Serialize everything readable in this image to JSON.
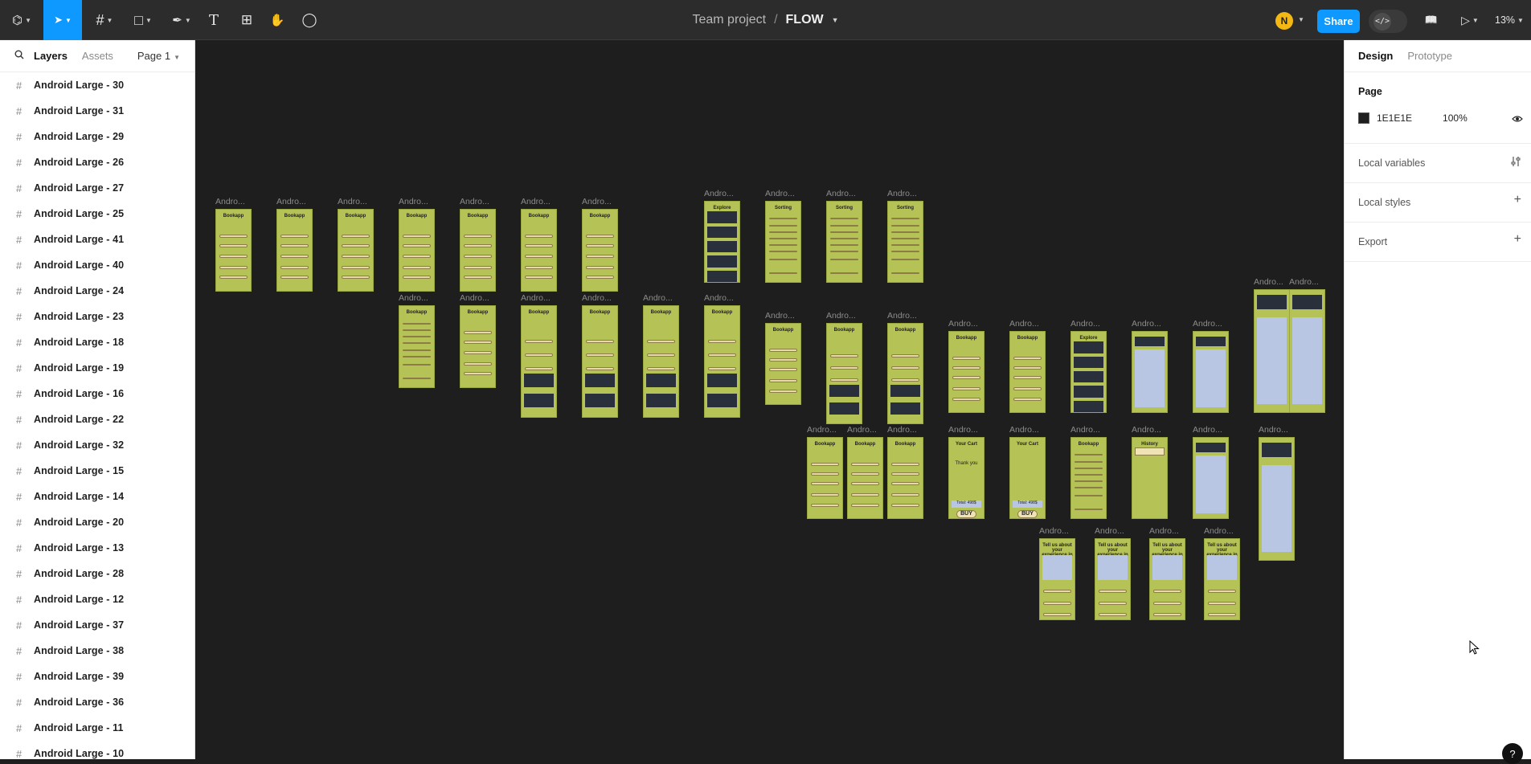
{
  "toolbar": {
    "tools": [
      {
        "name": "main-menu-icon",
        "glyph": "⌬"
      },
      {
        "name": "move-tool-icon",
        "glyph": "➤"
      },
      {
        "name": "frame-tool-icon",
        "glyph": "#"
      },
      {
        "name": "shape-tool-icon",
        "glyph": "□"
      },
      {
        "name": "pen-tool-icon",
        "glyph": "✒"
      },
      {
        "name": "text-tool-icon",
        "glyph": "T"
      },
      {
        "name": "resources-tool-icon",
        "glyph": "⊞"
      },
      {
        "name": "hand-tool-icon",
        "glyph": "✋"
      },
      {
        "name": "comment-tool-icon",
        "glyph": "◯"
      }
    ],
    "breadcrumb_team": "Team project",
    "breadcrumb_sep": "/",
    "file_name": "FLOW",
    "avatar_initial": "N",
    "share_label": "Share",
    "devmode_glyph": "</>",
    "library_glyph": "📖",
    "present_glyph": "▷",
    "zoom": "13%"
  },
  "left_panel": {
    "search_glyph": "🔍",
    "tab_layers": "Layers",
    "tab_assets": "Assets",
    "page_selector": "Page 1",
    "layers": [
      "Android Large - 30",
      "Android Large - 31",
      "Android Large - 29",
      "Android Large - 26",
      "Android Large - 27",
      "Android Large - 25",
      "Android Large - 41",
      "Android Large - 40",
      "Android Large - 24",
      "Android Large - 23",
      "Android Large - 18",
      "Android Large - 19",
      "Android Large - 16",
      "Android Large - 22",
      "Android Large - 32",
      "Android Large - 15",
      "Android Large - 14",
      "Android Large - 20",
      "Android Large - 13",
      "Android Large - 28",
      "Android Large - 12",
      "Android Large - 37",
      "Android Large - 38",
      "Android Large - 39",
      "Android Large - 36",
      "Android Large - 11",
      "Android Large - 10"
    ]
  },
  "right_panel": {
    "tab_design": "Design",
    "tab_prototype": "Prototype",
    "page_title": "Page",
    "page_color": "1E1E1E",
    "page_color_hex": "#1e1e1e",
    "page_opacity": "100%",
    "local_variables": "Local variables",
    "local_styles": "Local styles",
    "export": "Export"
  },
  "canvas": {
    "frame_label": "Andro...",
    "frame_color": "#b5c255",
    "background": "#1e1e1e",
    "frame_texts": {
      "bookapp": "Bookapp",
      "explore": "Explore",
      "sorting": "Sorting",
      "your_cart": "Your Cart",
      "history": "History",
      "buy": "BUY",
      "thank_you": "Thank you",
      "total": "Total: 498$",
      "tell_us": "Tell us about your experience in"
    }
  },
  "help_glyph": "?"
}
